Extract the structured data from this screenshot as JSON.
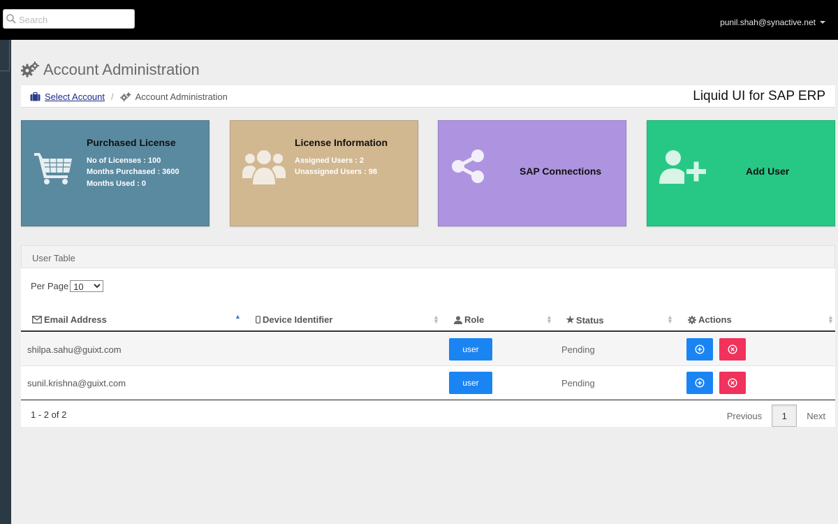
{
  "topbar": {
    "search_placeholder": "Search",
    "user_email": "punil.shah@synactive.net"
  },
  "page": {
    "title": "Account Administration",
    "breadcrumb": {
      "link": "Select Account",
      "separator": "/",
      "current": "Account Administration"
    },
    "product_title": "Liquid UI for SAP ERP"
  },
  "tiles": {
    "purchased": {
      "title": "Purchased License",
      "lines": [
        "No of Licenses : 100",
        "Months Purchased : 3600",
        "Months Used : 0"
      ],
      "color": "#5a8aa0",
      "icon": "cart-icon"
    },
    "license_info": {
      "title": "License Information",
      "lines": [
        "Assigned Users : 2",
        "Unassigned Users : 98"
      ],
      "color": "#d1b891",
      "icon": "users-group-icon"
    },
    "sap": {
      "title": "SAP Connections",
      "color": "#ae94e0",
      "icon": "share-icon"
    },
    "add_user": {
      "title": "Add User",
      "color": "#27c886",
      "icon": "add-user-icon"
    }
  },
  "table": {
    "panel_title": "User Table",
    "per_page_label": "Per Page",
    "per_page_value": "10",
    "columns": [
      "Email Address",
      "Device Identifier",
      "Role",
      "Status",
      "Actions"
    ],
    "rows": [
      {
        "email": "shilpa.sahu@guixt.com",
        "device": "",
        "role": "user",
        "status": "Pending"
      },
      {
        "email": "sunil.krishna@guixt.com",
        "device": "",
        "role": "user",
        "status": "Pending"
      }
    ],
    "range_text": "1 - 2 of 2",
    "pagination": {
      "previous": "Previous",
      "page": "1",
      "next": "Next"
    }
  },
  "colors": {
    "role_button": "#1b84f3",
    "add_action": "#1b84f3",
    "delete_action": "#f0325c"
  }
}
